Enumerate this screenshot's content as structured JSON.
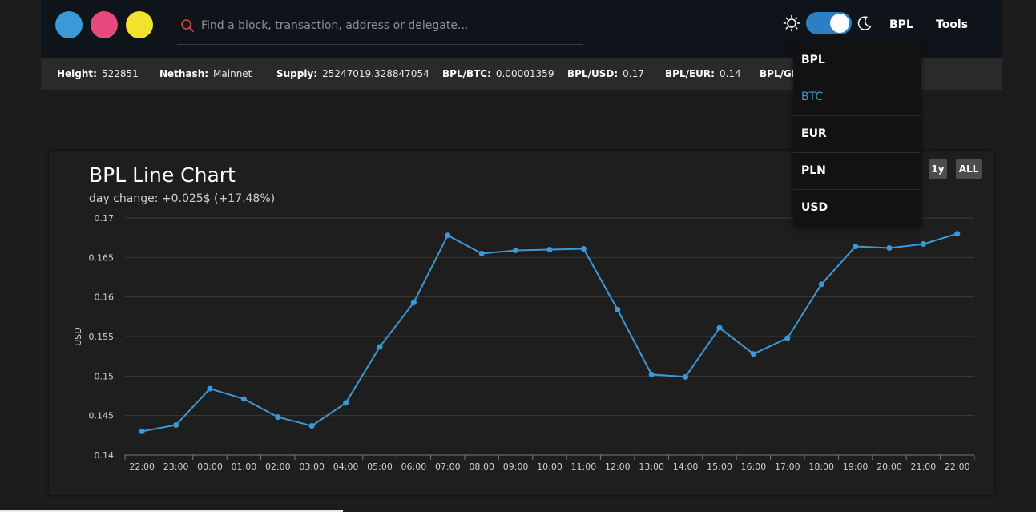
{
  "window_dots": [
    "#3a9ad9",
    "#e8497d",
    "#f2e22c"
  ],
  "search": {
    "placeholder": "Find a block, transaction, address or delegate..."
  },
  "header": {
    "currency_label": "BPL",
    "tools_label": "Tools"
  },
  "stats": [
    {
      "label": "Height:",
      "value": "522851"
    },
    {
      "label": "Nethash:",
      "value": "Mainnet"
    },
    {
      "label": "Supply:",
      "value": "25247019.328847054"
    },
    {
      "label": "BPL/BTC:",
      "value": "0.00001359"
    },
    {
      "label": "BPL/USD:",
      "value": "0.17"
    },
    {
      "label": "BPL/EUR:",
      "value": "0.14"
    },
    {
      "label": "BPL/GI",
      "value": ""
    }
  ],
  "currency_menu": [
    {
      "label": "BPL",
      "active": false
    },
    {
      "label": "BTC",
      "active": true
    },
    {
      "label": "EUR",
      "active": false
    },
    {
      "label": "PLN",
      "active": false
    },
    {
      "label": "USD",
      "active": false
    }
  ],
  "range_buttons": [
    "1y",
    "ALL"
  ],
  "colors": {
    "accent": "#3a9ad9",
    "topbar": "#0f131a"
  },
  "chart_data": {
    "type": "line",
    "title": "BPL Line Chart",
    "subtitle": "day change: +0.025$ (+17.48%)",
    "ylabel": "USD",
    "xlabel": "",
    "ylim": [
      0.14,
      0.17
    ],
    "y_ticks": [
      "0.14",
      "0.145",
      "0.15",
      "0.155",
      "0.16",
      "0.165",
      "0.17"
    ],
    "grid": true,
    "categories": [
      "22:00",
      "23:00",
      "00:00",
      "01:00",
      "02:00",
      "03:00",
      "04:00",
      "05:00",
      "06:00",
      "07:00",
      "08:00",
      "09:00",
      "10:00",
      "11:00",
      "12:00",
      "13:00",
      "14:00",
      "15:00",
      "16:00",
      "17:00",
      "18:00",
      "19:00",
      "20:00",
      "21:00",
      "22:00"
    ],
    "values": [
      0.143,
      0.1438,
      0.1484,
      0.1471,
      0.1448,
      0.1437,
      0.1466,
      0.1537,
      0.1593,
      0.1678,
      0.1655,
      0.1659,
      0.166,
      0.1661,
      0.1584,
      0.1502,
      0.1499,
      0.1561,
      0.1528,
      0.1548,
      0.1616,
      0.1664,
      0.1662,
      0.1667,
      0.168
    ]
  }
}
